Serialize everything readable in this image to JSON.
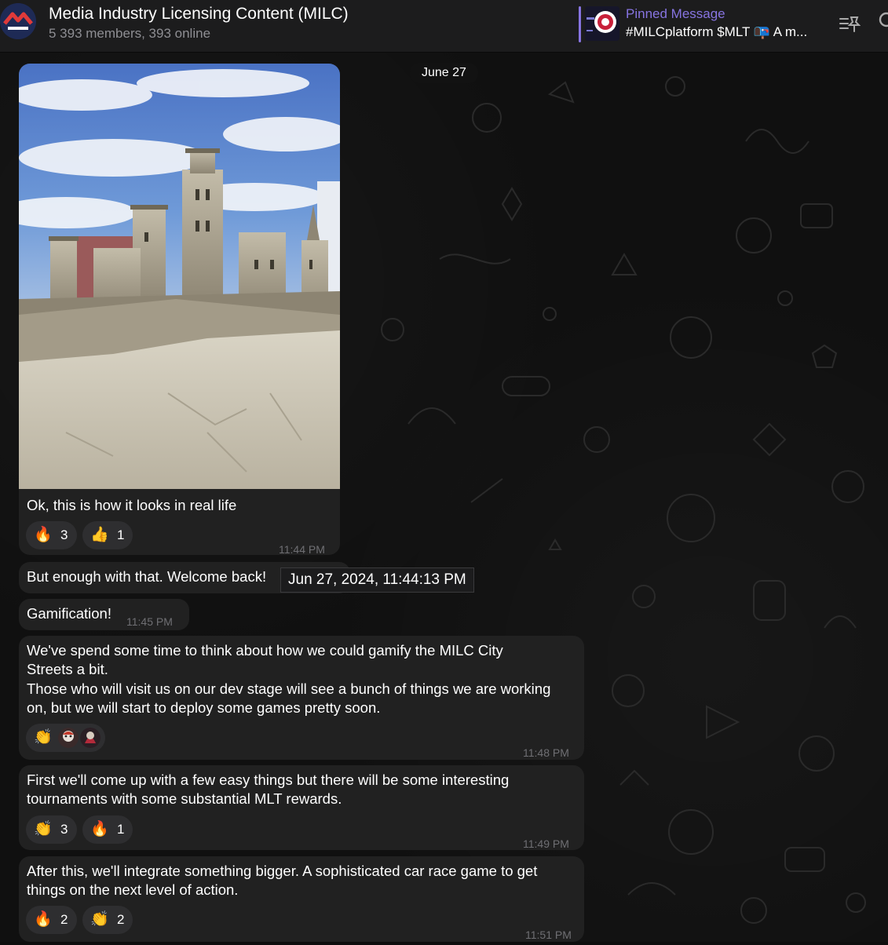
{
  "header": {
    "title": "Media Industry Licensing Content (MILC)",
    "subtitle": "5 393 members, 393 online",
    "pinned_label": "Pinned Message",
    "pinned_text": "#MILCplatform $MLT 📭 A m..."
  },
  "date_separator": "June 27",
  "tooltip": "Jun 27, 2024, 11:44:13 PM",
  "messages": [
    {
      "lines": [
        "Ok, this is how it looks in real life"
      ],
      "time": "11:44 PM",
      "reactions": [
        {
          "emoji": "🔥",
          "count": "3"
        },
        {
          "emoji": "👍",
          "count": "1"
        }
      ]
    },
    {
      "lines": [
        "But enough with that. Welcome back!"
      ]
    },
    {
      "lines": [
        "Gamification!"
      ],
      "time": "11:45 PM"
    },
    {
      "lines": [
        "We've spend some time to think about how we could gamify the MILC City",
        "Streets a bit.",
        "Those who will visit us on our dev stage will see a bunch of things we are working",
        "on, but we will start to deploy some games pretty soon."
      ],
      "time": "11:48 PM",
      "reactions": [
        {
          "emoji": "👏"
        }
      ]
    },
    {
      "lines": [
        "First we'll come up with a few easy things but there will be some interesting",
        "tournaments with some substantial MLT rewards."
      ],
      "time": "11:49 PM",
      "reactions": [
        {
          "emoji": "👏",
          "count": "3"
        },
        {
          "emoji": "🔥",
          "count": "1"
        }
      ]
    },
    {
      "lines": [
        "After this, we'll integrate something bigger. A sophisticated car race game to get",
        "things on the next level of action."
      ],
      "time": "11:51 PM",
      "reactions": [
        {
          "emoji": "🔥",
          "count": "2"
        },
        {
          "emoji": "👏",
          "count": "2"
        }
      ]
    }
  ],
  "icons": {
    "avatar": "milc-logo",
    "pinned_thumb": "milc-platform-thumbnail",
    "pinned_list": "pin-list-icon",
    "search": "search-icon",
    "photo": "castle-photo"
  },
  "colors": {
    "accent": "#8774e1",
    "bubble": "#212121",
    "header": "#1c1c1d",
    "time": "#6f6f73"
  }
}
